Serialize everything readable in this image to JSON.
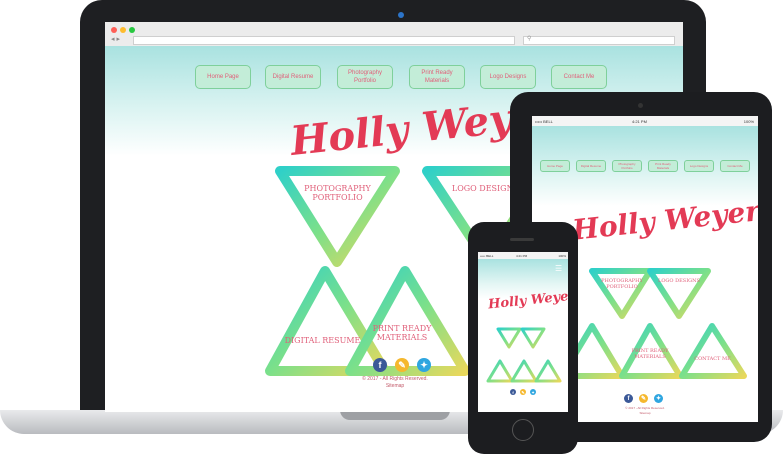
{
  "site": {
    "title": "Holly Weyer",
    "nav": [
      {
        "label": "Home Page"
      },
      {
        "label": "Digital Resume"
      },
      {
        "label": "Photography Portfolio"
      },
      {
        "label": "Print Ready Materials"
      },
      {
        "label": "Logo Designs"
      },
      {
        "label": "Contact Me"
      }
    ],
    "triangles": [
      {
        "label": "Photography Portfolio",
        "orientation": "down"
      },
      {
        "label": "Logo Designs",
        "orientation": "down"
      },
      {
        "label": "Digital Resume",
        "orientation": "up"
      },
      {
        "label": "Print Ready Materials",
        "orientation": "up"
      },
      {
        "label": "Contact Me",
        "orientation": "up"
      }
    ],
    "social": [
      {
        "icon": "facebook-icon",
        "glyph": "f",
        "color": "#3b5998"
      },
      {
        "icon": "openoffice-icon",
        "glyph": "✎",
        "color": "#f5b82e"
      },
      {
        "icon": "twitter-icon",
        "glyph": "✦",
        "color": "#2fa6e0"
      }
    ],
    "copyright": "© 2017 - All Rights Reserved.",
    "sitemap": "Sitemap"
  },
  "tablet": {
    "carrier": "••••• BELL",
    "time": "4:21 PM",
    "battery": "100%"
  },
  "phone": {
    "carrier": "••••• BELL",
    "time": "4:21 PM",
    "battery": "100%"
  },
  "colors": {
    "accent": "#e33a55",
    "nav_bg": "#c3edd8",
    "nav_border": "#7fd09b",
    "header_teal": "#a9e2e0"
  }
}
